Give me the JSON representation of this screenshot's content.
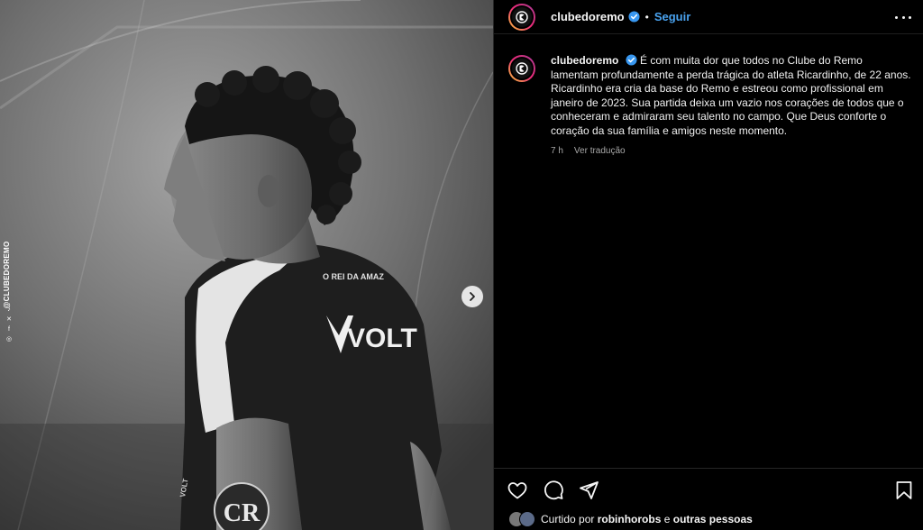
{
  "post": {
    "username": "clubedoremo",
    "separator": "•",
    "follow_label": "Seguir",
    "more_label": "Mais opções",
    "caption_lines": [
      "É com muita dor que todos no Clube do Remo lamentam profundamente a perda trágica do atleta Ricardinho, de 22 anos.",
      "Ricardinho era cria da base do Remo e estreou como profissional em janeiro de 2023. Sua partida deixa um vazio nos corações de todos que o conheceram e admiraram seu talento no campo. Que Deus conforte o coração da sua família e amigos neste momento."
    ],
    "time_ago": "7 h",
    "translate_label": "Ver tradução",
    "liked_by_prefix": "Curtido por",
    "liked_by_user": "robinhorobs",
    "liked_by_connector": "e",
    "liked_by_suffix": "outras pessoas"
  },
  "photo": {
    "side_handle": "@CLUBEDOREMO",
    "jersey_text_top": "O REI DA AMAZ",
    "jersey_brand": "VOLT",
    "badge_letters": "CR"
  },
  "icons": {
    "like": "heart-icon",
    "comment": "comment-icon",
    "share": "send-icon",
    "save": "bookmark-icon",
    "next": "chevron-right-icon",
    "verified": "verified-badge-icon"
  },
  "colors": {
    "background": "#000000",
    "text": "#f5f5f5",
    "follow": "#4aa3f0",
    "muted": "#a8a8a8",
    "verified": "#3897f0"
  }
}
